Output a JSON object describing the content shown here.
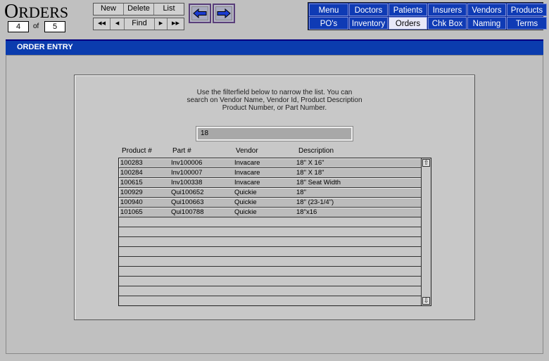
{
  "app": {
    "title_first": "O",
    "title_rest": "RDERS"
  },
  "record": {
    "current": "4",
    "of_label": "of",
    "total": "5"
  },
  "toolbar": {
    "new_label": "New",
    "delete_label": "Delete",
    "list_label": "List",
    "first_label": "◂◂",
    "prev_label": "◂",
    "find_label": "Find",
    "next_label": "▸",
    "last_label": "▸▸"
  },
  "nav": {
    "items": [
      {
        "label": "Menu"
      },
      {
        "label": "Doctors"
      },
      {
        "label": "Patients"
      },
      {
        "label": "Insurers"
      },
      {
        "label": "Vendors"
      },
      {
        "label": "Products"
      },
      {
        "label": "PO's"
      },
      {
        "label": "Inventory"
      },
      {
        "label": "Orders",
        "active": true
      },
      {
        "label": "Chk Box"
      },
      {
        "label": "Naming"
      },
      {
        "label": "Terms"
      }
    ]
  },
  "section": {
    "title": "ORDER ENTRY"
  },
  "panel": {
    "instructions": "Use the filterfield below to narrow the list.  You can\nsearch on Vendor Name, Vendor Id, Product Description\nProduct Number, or Part Number.",
    "filter_value": "18",
    "columns": [
      "Product #",
      "Part #",
      "Vendor",
      "Description"
    ],
    "rows": [
      [
        "100283",
        "Inv100006",
        "Invacare",
        "18\"  X  16\""
      ],
      [
        "100284",
        "Inv100007",
        "Invacare",
        "18\"  X  18\""
      ],
      [
        "100615",
        "Inv100338",
        "Invacare",
        "18\" Seat Width"
      ],
      [
        "100929",
        "Qui100652",
        "Quickie",
        "18\""
      ],
      [
        "100940",
        "Qui100663",
        "Quickie",
        "18\" (23-1/4\")"
      ],
      [
        "101065",
        "Qui100788",
        "Quickie",
        "18\"x16"
      ]
    ]
  },
  "colors": {
    "nav_bg": "#0f3bb5",
    "header_bg": "#0b3cae",
    "active_tab": "#e8e8f8"
  }
}
